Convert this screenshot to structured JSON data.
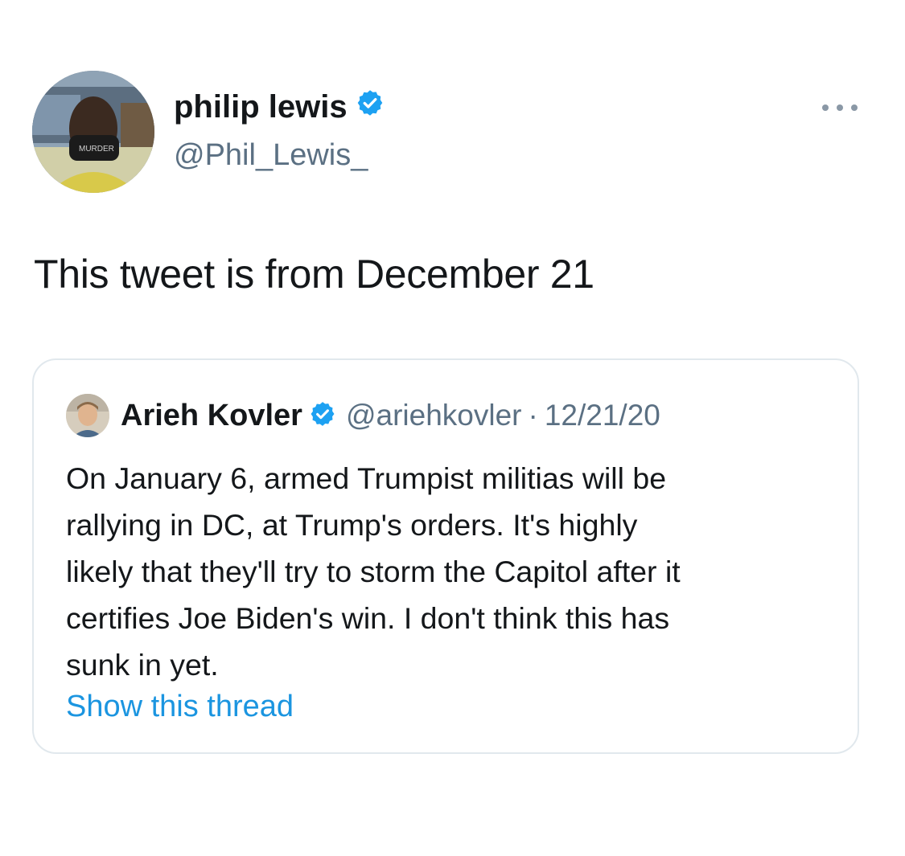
{
  "author": {
    "display_name": "philip lewis",
    "handle": "@Phil_Lewis_",
    "verified": true,
    "avatar_icon": "profile-photo"
  },
  "more_icon": "ellipsis-icon",
  "tweet": {
    "text": "This tweet is from December 21"
  },
  "quoted_tweet": {
    "display_name": "Arieh Kovler",
    "handle": "@ariehkovler",
    "separator": "·",
    "date": "12/21/20",
    "verified": true,
    "body_lines": [
      "On January 6, armed Trumpist militias will be",
      "rallying in DC, at Trump's orders. It's highly",
      "likely that they'll try to storm the Capitol after it",
      "certifies Joe Biden's win. I don't think this has",
      "sunk in yet."
    ],
    "show_thread_label": "Show this thread"
  },
  "colors": {
    "verified_badge": "#1da1f2",
    "link": "#1b95e0",
    "secondary_text": "#5b7083",
    "border": "#e1e8ed"
  }
}
